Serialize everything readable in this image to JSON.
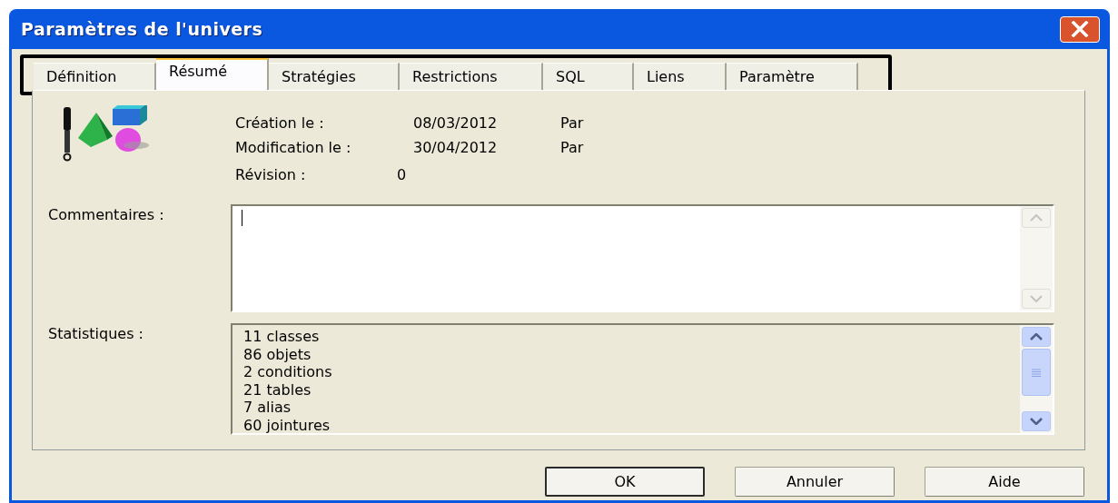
{
  "window": {
    "title": "Paramètres de l'univers"
  },
  "tabs": [
    {
      "label": "Définition",
      "selected": false
    },
    {
      "label": "Résumé",
      "selected": true
    },
    {
      "label": "Stratégies",
      "selected": false
    },
    {
      "label": "Restrictions",
      "selected": false
    },
    {
      "label": "SQL",
      "selected": false
    },
    {
      "label": "Liens",
      "selected": false
    },
    {
      "label": "Paramètre",
      "selected": false
    }
  ],
  "summary": {
    "rows": [
      {
        "label": "Création le :",
        "date": "08/03/2012",
        "by": "Par"
      },
      {
        "label": "Modification le :",
        "date": "30/04/2012",
        "by": "Par"
      }
    ],
    "revision": {
      "label": "Révision :",
      "value": "0"
    }
  },
  "comments": {
    "label": "Commentaires :"
  },
  "statistics": {
    "label": "Statistiques :",
    "lines": [
      "11 classes",
      "86 objets",
      "2 conditions",
      "21 tables",
      "7 alias",
      "60 jointures"
    ]
  },
  "buttons": [
    {
      "label": "OK",
      "default": true
    },
    {
      "label": "Annuler",
      "default": false
    },
    {
      "label": "Aide",
      "default": false
    }
  ]
}
